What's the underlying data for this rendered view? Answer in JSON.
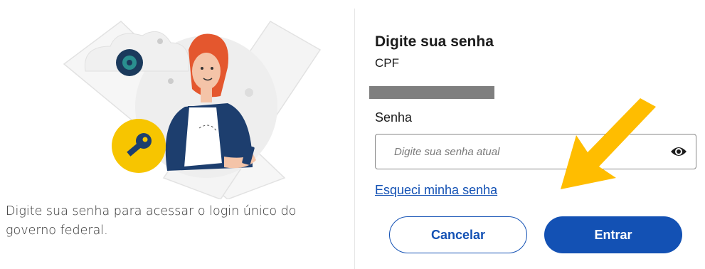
{
  "description": "Digite sua senha para acessar o login único do governo federal.",
  "form": {
    "title": "Digite sua senha",
    "cpf_label": "CPF",
    "cpf_value": "",
    "password_label": "Senha",
    "password_placeholder": "Digite sua senha atual",
    "forgot_link": "Esqueci minha senha",
    "cancel_label": "Cancelar",
    "submit_label": "Entrar"
  },
  "icons": {
    "password_toggle": "eye-icon",
    "key": "key-icon",
    "annotation": "arrow-icon"
  },
  "colors": {
    "primary": "#1351b4",
    "annotation_arrow": "#ffbd00",
    "key_badge": "#f7c500"
  }
}
